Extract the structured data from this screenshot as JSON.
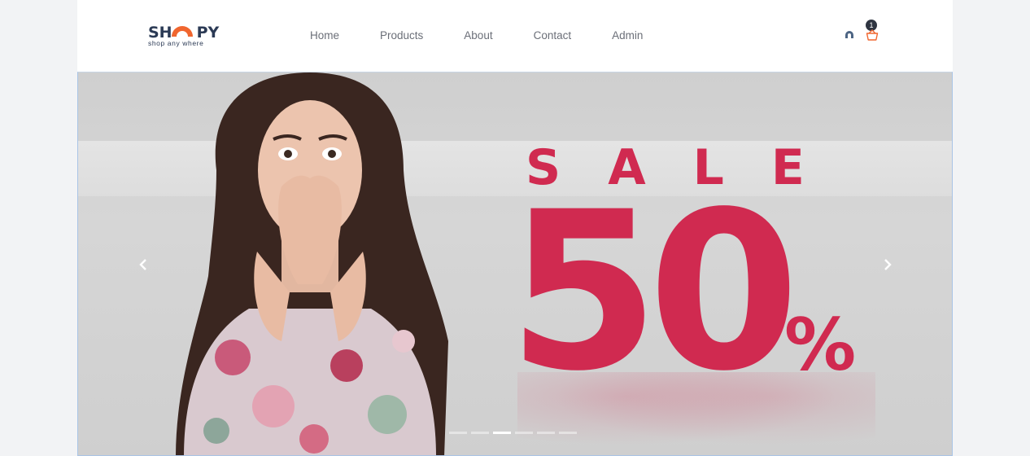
{
  "header": {
    "logo": {
      "text_left": "SH",
      "text_right": "PY",
      "tagline": "shop any where",
      "accent_color": "#f0662f"
    },
    "nav": [
      {
        "label": "Home"
      },
      {
        "label": "Products"
      },
      {
        "label": "About"
      },
      {
        "label": "Contact"
      },
      {
        "label": "Admin"
      }
    ],
    "cart_count": "1",
    "icons": {
      "user": "user-icon",
      "cart": "basket-icon"
    }
  },
  "carousel": {
    "banner": {
      "headline": "SALE",
      "discount": "50",
      "percent_sign": "%",
      "accent_color": "#d02a50"
    },
    "controls": {
      "prev_icon": "chevron-left-icon",
      "next_icon": "chevron-right-icon"
    },
    "slide_count": 6,
    "active_slide": 3
  }
}
